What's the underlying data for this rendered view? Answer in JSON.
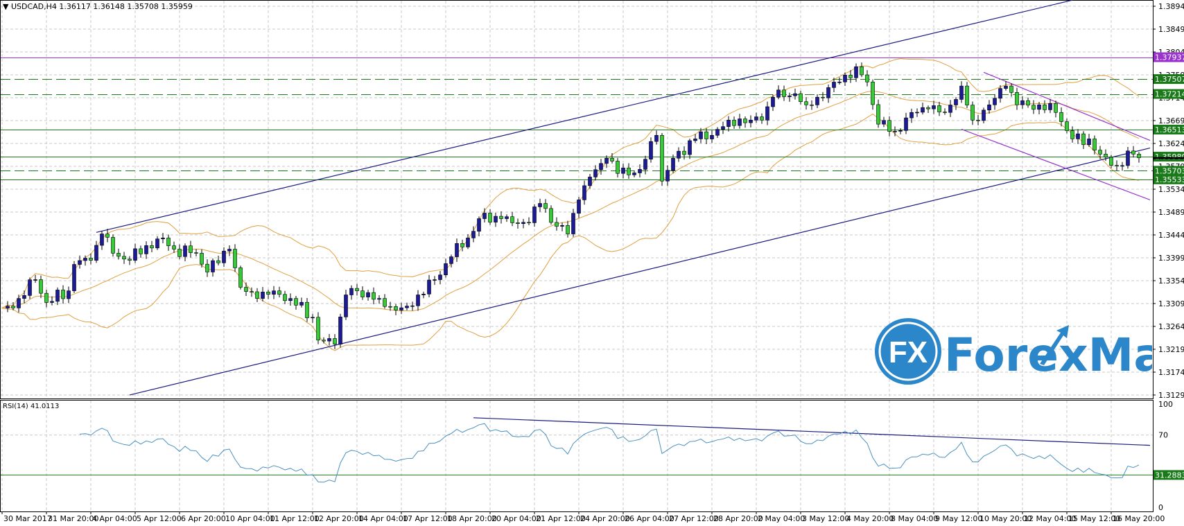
{
  "header": {
    "symbol": "USDCAD,H4",
    "open": "1.36117",
    "high": "1.36148",
    "low": "1.35708",
    "close": "1.35959"
  },
  "rsi_header": "RSI(14) 41.0113",
  "watermark": {
    "brand": "ForexMart",
    "badge": "FX",
    "color": "#2b87c9"
  },
  "colors": {
    "bull": "#1a1a9a",
    "bear": "#33cc33",
    "bands": "#e0a040",
    "channel": "#1a1a80",
    "purple": "#9933cc",
    "level_green": "#1a7a1a",
    "rsi_line": "#4a90c0"
  },
  "chart_data": [
    {
      "type": "candlestick",
      "title": "USDCAD,H4",
      "ylim": [
        1.3115,
        1.3902
      ],
      "y_ticks": [
        "1.38940",
        "1.38490",
        "1.38040",
        "1.37590",
        "1.37140",
        "1.36690",
        "1.36240",
        "1.35790",
        "1.35340",
        "1.34890",
        "1.34440",
        "1.33990",
        "1.33540",
        "1.33090",
        "1.32640",
        "1.32190",
        "1.31740",
        "1.31290"
      ],
      "x_ticks": [
        "30 Mar 2017",
        "31 Mar 20:00",
        "4 Apr 04:00",
        "5 Apr 12:00",
        "6 Apr 20:00",
        "10 Apr 04:00",
        "11 Apr 12:00",
        "12 Apr 20:00",
        "14 Apr 04:00",
        "17 Apr 12:00",
        "18 Apr 20:00",
        "20 Apr 04:00",
        "21 Apr 12:00",
        "24 Apr 20:00",
        "26 Apr 04:00",
        "27 Apr 12:00",
        "28 Apr 20:00",
        "2 May 04:00",
        "3 May 12:00",
        "4 May 20:00",
        "8 May 04:00",
        "9 May 12:00",
        "10 May 20:00",
        "12 May 04:00",
        "15 May 12:00",
        "16 May 20:00"
      ],
      "bars_per_x_tick": 8,
      "bar_count": 206,
      "close_keypoints": [
        [
          0,
          1.33
        ],
        [
          1,
          1.3304
        ],
        [
          3,
          1.3319
        ],
        [
          6,
          1.3356
        ],
        [
          8,
          1.3311
        ],
        [
          12,
          1.3334
        ],
        [
          13,
          1.3386
        ],
        [
          16,
          1.3394
        ],
        [
          18,
          1.3446
        ],
        [
          20,
          1.3408
        ],
        [
          23,
          1.3394
        ],
        [
          26,
          1.3423
        ],
        [
          29,
          1.3438
        ],
        [
          31,
          1.3416
        ],
        [
          35,
          1.3408
        ],
        [
          37,
          1.3371
        ],
        [
          41,
          1.3416
        ],
        [
          43,
          1.3341
        ],
        [
          46,
          1.3319
        ],
        [
          49,
          1.3334
        ],
        [
          52,
          1.3319
        ],
        [
          56,
          1.3282
        ],
        [
          57,
          1.3237
        ],
        [
          60,
          1.3229
        ],
        [
          62,
          1.3326
        ],
        [
          64,
          1.3334
        ],
        [
          68,
          1.3319
        ],
        [
          71,
          1.3296
        ],
        [
          73,
          1.3304
        ],
        [
          75,
          1.3326
        ],
        [
          78,
          1.3356
        ],
        [
          81,
          1.3401
        ],
        [
          84,
          1.3438
        ],
        [
          86,
          1.3476
        ],
        [
          90,
          1.3476
        ],
        [
          92,
          1.3468
        ],
        [
          95,
          1.3468
        ],
        [
          97,
          1.3506
        ],
        [
          100,
          1.3461
        ],
        [
          102,
          1.3446
        ],
        [
          104,
          1.3513
        ],
        [
          106,
          1.3558
        ],
        [
          109,
          1.3595
        ],
        [
          111,
          1.3565
        ],
        [
          115,
          1.3573
        ],
        [
          118,
          1.364
        ],
        [
          119,
          1.355
        ],
        [
          121,
          1.3595
        ],
        [
          125,
          1.3633
        ],
        [
          128,
          1.364
        ],
        [
          131,
          1.367
        ],
        [
          135,
          1.367
        ],
        [
          137,
          1.367
        ],
        [
          139,
          1.3715
        ],
        [
          143,
          1.3722
        ],
        [
          145,
          1.37
        ],
        [
          147,
          1.3715
        ],
        [
          151,
          1.3745
        ],
        [
          154,
          1.3775
        ],
        [
          156,
          1.3745
        ],
        [
          158,
          1.3662
        ],
        [
          161,
          1.3648
        ],
        [
          164,
          1.3685
        ],
        [
          167,
          1.3692
        ],
        [
          170,
          1.3685
        ],
        [
          173,
          1.3737
        ],
        [
          175,
          1.367
        ],
        [
          178,
          1.37
        ],
        [
          181,
          1.3737
        ],
        [
          183,
          1.37
        ],
        [
          187,
          1.37
        ],
        [
          190,
          1.3685
        ],
        [
          193,
          1.3633
        ],
        [
          196,
          1.3633
        ],
        [
          198,
          1.3603
        ],
        [
          201,
          1.358
        ],
        [
          204,
          1.3603
        ],
        [
          205,
          1.35959
        ]
      ],
      "indicators": {
        "bollinger": {
          "period": 20,
          "deviations": 2
        }
      },
      "levels": [
        {
          "value": "1.37937",
          "style": "solid",
          "color": "purple"
        },
        {
          "value": "1.37507",
          "style": "dashed",
          "color": "level_green"
        },
        {
          "value": "1.37214",
          "style": "dashed",
          "color": "level_green"
        },
        {
          "value": "1.36513",
          "style": "solid",
          "color": "level_green"
        },
        {
          "value": "1.35980",
          "style": "solid",
          "color": "level_green"
        },
        {
          "value": "1.35703",
          "style": "dashed",
          "color": "level_green"
        },
        {
          "value": "1.35533",
          "style": "solid",
          "color": "level_green"
        }
      ],
      "trendlines": [
        {
          "name": "channel-upper",
          "from": [
            17,
            1.3449
          ],
          "to": [
            193,
            1.3906
          ],
          "color": "channel"
        },
        {
          "name": "channel-lower",
          "from": [
            23,
            1.3129
          ],
          "to": [
            207,
            1.3615
          ],
          "color": "channel"
        },
        {
          "name": "down-channel-upper",
          "from": [
            177,
            1.3764
          ],
          "to": [
            207,
            1.363
          ],
          "color": "purple"
        },
        {
          "name": "down-channel-lower",
          "from": [
            173,
            1.3652
          ],
          "to": [
            207,
            1.3513
          ],
          "color": "purple"
        }
      ]
    },
    {
      "type": "line",
      "title": "RSI(14) 41.0113",
      "ylim": [
        0,
        100
      ],
      "y_ticks": [
        "100",
        "70",
        "0"
      ],
      "level": "31.2883",
      "trendline": {
        "from": [
          85,
          86.7
        ],
        "to": [
          207,
          60
        ]
      },
      "last_value": 41.0113
    }
  ]
}
